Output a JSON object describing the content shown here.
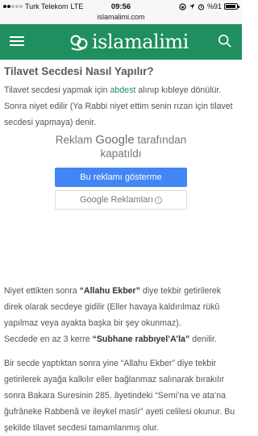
{
  "status_bar": {
    "carrier": "Turk Telekom",
    "network": "LTE",
    "time": "09:56",
    "url": "islamalimi.com",
    "battery": "%91",
    "battery_level": 0.91
  },
  "header": {
    "logo_text": "islamalimi",
    "menu_icon": "hamburger-menu-icon",
    "search_icon": "search-icon"
  },
  "article": {
    "title": "Tilavet Secdesi Nasıl Yapılır?",
    "p1_a": "Tilavet secdesi yapmak için ",
    "p1_link": "abdest",
    "p1_b": " alınıp kıbleye dönülür.",
    "p2": "Sonra niyet edilir (Ya Rabbi niyet ettim senin rızan için tilavet secdesi yapmaya) denir.",
    "p3_a": "Niyet ettikten sonra ",
    "p3_bold": "“Allahu Ekber”",
    "p3_b": " diye tekbir getirilerek direk olarak secdeye gidilir (Eller havaya kaldırılmaz rükû yapılmaz veya ayakta başka bir şey okunmaz).",
    "p4_a": "Secdede en az 3 kerre ",
    "p4_bold": "“Subhane rabbıyel’A’la”",
    "p4_b": " denilir.",
    "p5": "Bir secde yaptıktan sonra yine “Allahu Ekber” diye tekbir getirilerek ayağa kalkılır eller bağlanmaz salınarak bırakılır sonra Bakara Suresinin 285. âyetindeki “Semi’na ve ata’na ğufrâneke Rabbenâ ve ileykel masîr” ayeti celilesi okunur. Bu şekilde tilavet secdesi tamamlanmış olur."
  },
  "ad": {
    "label_a": "Reklam ",
    "label_brand": "Google",
    "label_b": " tarafından kapatıldı",
    "primary_button": "Bu reklamı gösterme",
    "secondary_button": "Google Reklamları",
    "info_icon": "info-icon"
  },
  "colors": {
    "brand_green": "#1f8f60",
    "ad_blue": "#4285f4"
  }
}
